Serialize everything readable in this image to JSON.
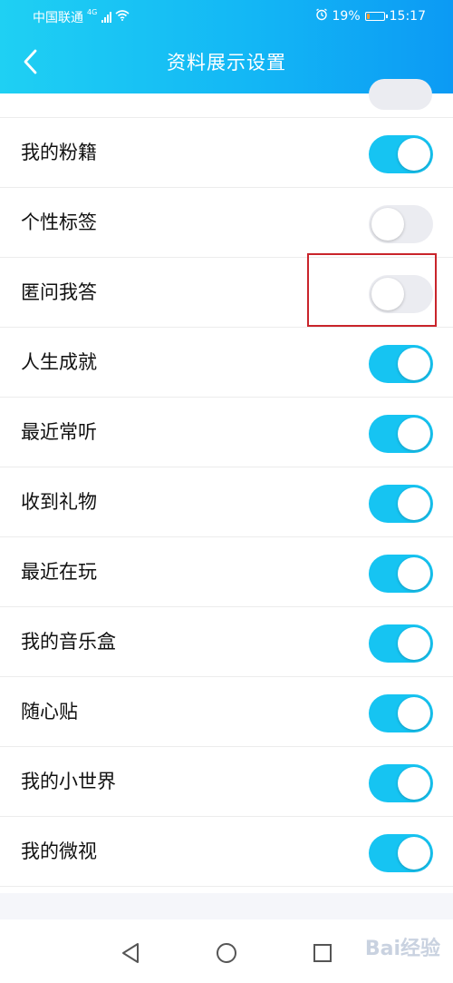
{
  "status_bar": {
    "carrier": "中国联通",
    "network": "4G",
    "battery": "19%",
    "battery_level": 0.19,
    "time": "15:17",
    "icons": [
      "signal-icon",
      "wifi-icon",
      "alarm-icon",
      "battery-icon"
    ]
  },
  "header": {
    "back_icon": "chevron-left-icon",
    "title": "资料展示设置"
  },
  "settings": {
    "items": [
      {
        "label": "我的粉籍",
        "enabled": true
      },
      {
        "label": "个性标签",
        "enabled": false
      },
      {
        "label": "匿问我答",
        "enabled": false
      },
      {
        "label": "人生成就",
        "enabled": true
      },
      {
        "label": "最近常听",
        "enabled": true
      },
      {
        "label": "收到礼物",
        "enabled": true
      },
      {
        "label": "最近在玩",
        "enabled": true
      },
      {
        "label": "我的音乐盒",
        "enabled": true
      },
      {
        "label": "随心贴",
        "enabled": true
      },
      {
        "label": "我的小世界",
        "enabled": true
      },
      {
        "label": "我的微视",
        "enabled": true
      }
    ]
  },
  "nav_bar": {
    "icons": [
      "back-triangle-icon",
      "home-circle-icon",
      "recents-square-icon"
    ]
  },
  "watermark": "Bai经验",
  "colors": {
    "header_gradient_start": "#1fd0f3",
    "header_gradient_end": "#0c9af4",
    "toggle_on": "#16c4f2",
    "toggle_off": "#ebecf1",
    "highlight": "#c9242b"
  }
}
